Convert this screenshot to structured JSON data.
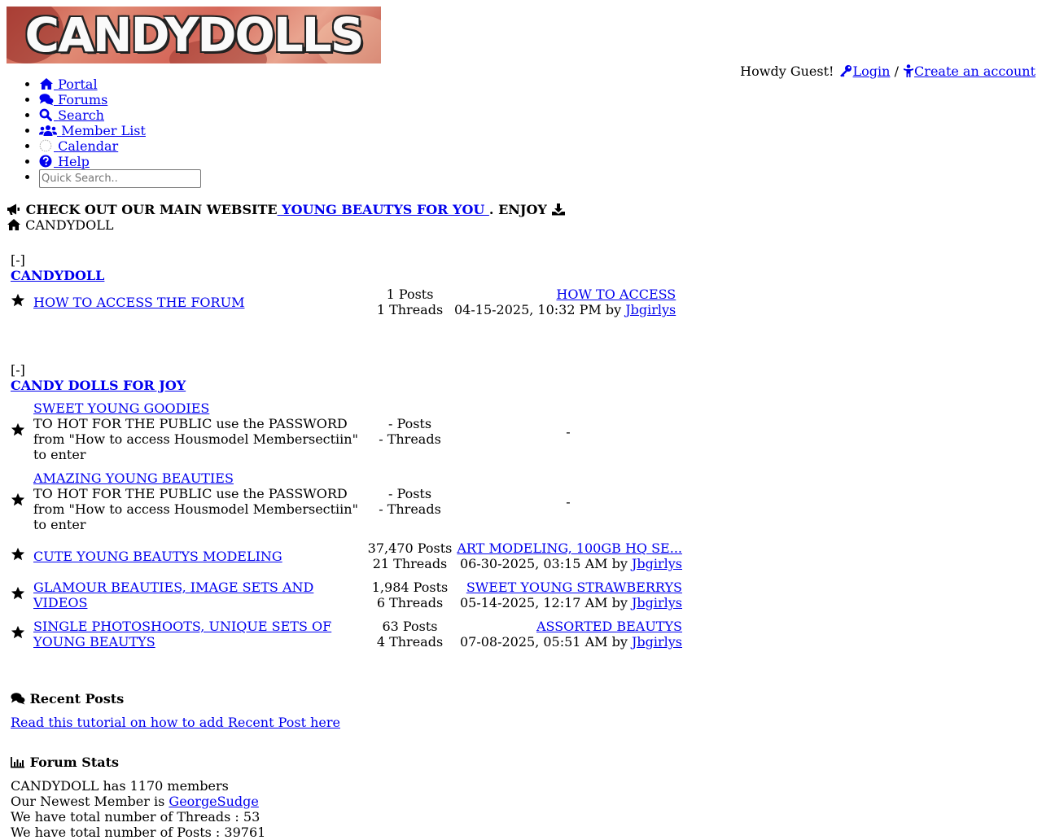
{
  "logo": {
    "text": "CANDYDOLLS"
  },
  "header": {
    "greeting": "Howdy Guest!",
    "login": "Login",
    "separator": "/",
    "register": "Create an account"
  },
  "nav": {
    "items": [
      {
        "label": "Portal",
        "icon": "home-icon"
      },
      {
        "label": "Forums",
        "icon": "comments-icon"
      },
      {
        "label": "Search",
        "icon": "search-icon"
      },
      {
        "label": "Member List",
        "icon": "users-icon"
      },
      {
        "label": "Calendar",
        "icon": "calendar-icon"
      },
      {
        "label": "Help",
        "icon": "question-icon"
      }
    ],
    "search_placeholder": "Quick Search.."
  },
  "announcement": {
    "prefix": "CHECK OUT  OUR MAIN WEBSITE",
    "link": " YOUNG BEAUTYS FOR YOU ",
    "suffix": ". ENJOY"
  },
  "breadcrumb": "CANDYDOLL",
  "categories": [
    {
      "toggle": "[-]",
      "title": "CANDYDOLL",
      "forums": [
        {
          "title": "HOW TO ACCESS THE FORUM",
          "desc": "",
          "posts": "1 Posts",
          "threads": "1 Threads",
          "last_title": "HOW TO ACCESS",
          "last_date": "04-15-2025, 10:32 PM by",
          "last_user": "Jbgirlys"
        }
      ]
    },
    {
      "toggle": "[-]",
      "title": "CANDY DOLLS FOR JOY",
      "forums": [
        {
          "title": "SWEET YOUNG GOODIES",
          "desc": "TO HOT FOR THE PUBLIC use the PASSWORD from \"How to access Housmodel Membersectiin\" to enter",
          "posts": "- Posts",
          "threads": "- Threads",
          "last_dash": "-"
        },
        {
          "title": "AMAZING YOUNG BEAUTIES",
          "desc": "TO HOT FOR THE PUBLIC use the PASSWORD from \"How to access Housmodel Membersectiin\" to enter",
          "posts": "- Posts",
          "threads": "- Threads",
          "last_dash": "-"
        },
        {
          "title": "CUTE YOUNG BEAUTYS MODELING",
          "desc": "",
          "posts": "37,470 Posts",
          "threads": "21 Threads",
          "last_title": "ART MODELING, 100GB HQ SE...",
          "last_date": "06-30-2025, 03:15 AM by",
          "last_user": "Jbgirlys"
        },
        {
          "title": "GLAMOUR BEAUTIES, IMAGE SETS AND VIDEOS",
          "desc": "",
          "posts": "1,984 Posts",
          "threads": "6 Threads",
          "last_title": "SWEET YOUNG STRAWBERRYS",
          "last_date": "05-14-2025, 12:17 AM by",
          "last_user": "Jbgirlys"
        },
        {
          "title": "SINGLE PHOTOSHOOTS, UNIQUE SETS OF YOUNG BEAUTYS",
          "desc": "",
          "posts": "63 Posts",
          "threads": "4 Threads",
          "last_title": "ASSORTED BEAUTYS",
          "last_date": "07-08-2025, 05:51 AM by",
          "last_user": "Jbgirlys"
        }
      ]
    }
  ],
  "recent_posts": {
    "heading": "Recent Posts",
    "link": "Read this tutorial on how to add Recent Post here"
  },
  "stats": {
    "heading": "Forum Stats",
    "members_line": "CANDYDOLL has 1170 members",
    "newest_prefix": "Our Newest Member is ",
    "newest_user": "GeorgeSudge",
    "threads_line": "We have total number of Threads : 53",
    "posts_line": "We have total number of Posts : 39761"
  }
}
